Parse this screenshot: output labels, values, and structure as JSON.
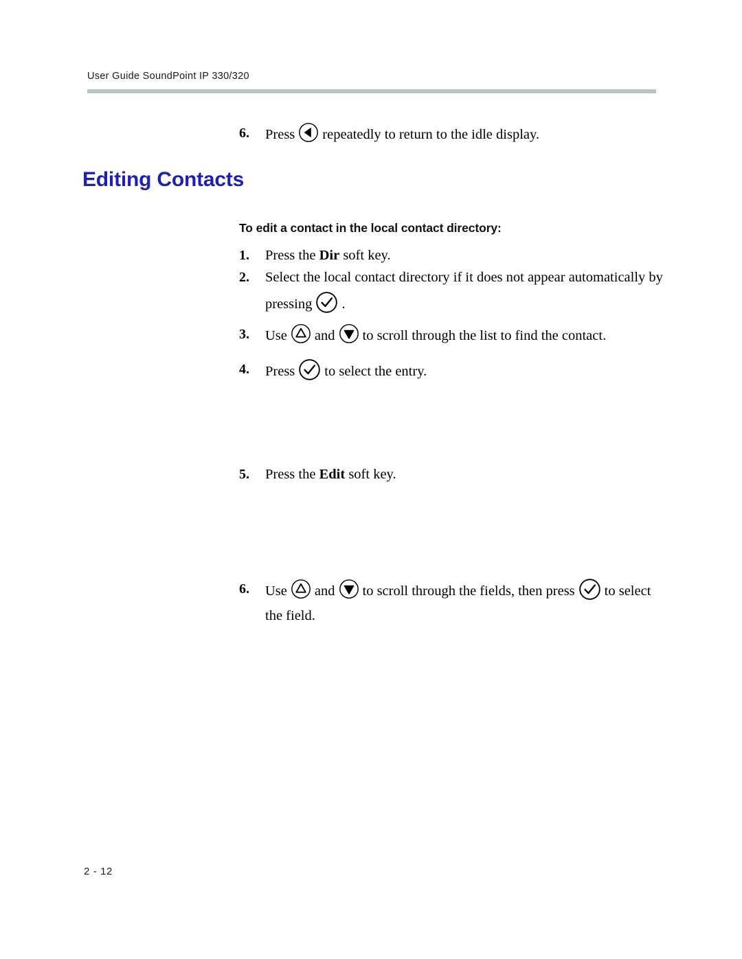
{
  "header": {
    "running_title": "User Guide SoundPoint IP 330/320",
    "rule_color": "#b9c4c6"
  },
  "footer": {
    "page_number": "2 - 12"
  },
  "top_step": {
    "number": "6.",
    "text_before": "Press",
    "icon": "left-arrow-key-icon",
    "text_after": "repeatedly to return to the idle display."
  },
  "section": {
    "title": "Editing Contacts",
    "title_color": "#1f1fb4"
  },
  "procedure": {
    "heading": "To edit a contact in the local contact directory:",
    "steps": [
      {
        "number": "1.",
        "parts": [
          {
            "type": "text",
            "value": "Press the "
          },
          {
            "type": "bold",
            "value": "Dir"
          },
          {
            "type": "text",
            "value": " soft key."
          }
        ],
        "plain": "Press the Dir soft key."
      },
      {
        "number": "2.",
        "line1": "Select the local contact directory if it does not appear automatically by",
        "line2_before": "pressing",
        "line2_icon": "checkmark-key-icon",
        "line2_after": ".",
        "plain": "Select the local contact directory if it does not appear automatically by pressing ."
      },
      {
        "number": "3.",
        "text_before": "Use",
        "icon_1": "up-arrow-key-icon",
        "text_middle": "and",
        "icon_2": "down-arrow-key-icon",
        "text_after": "to scroll through the list to find the contact.",
        "plain": "Use and to scroll through the list to find the contact."
      },
      {
        "number": "4.",
        "text_before": "Press",
        "icon": "checkmark-key-icon",
        "text_after": "to select the entry.",
        "plain": "Press to select the entry."
      },
      {
        "number": "5.",
        "parts": [
          {
            "type": "text",
            "value": "Press the "
          },
          {
            "type": "bold",
            "value": "Edit"
          },
          {
            "type": "text",
            "value": " soft key."
          }
        ],
        "plain": "Press the Edit soft key."
      },
      {
        "number": "6.",
        "text_before": "Use",
        "icon_1": "up-arrow-key-icon",
        "text_middle": "and",
        "icon_2": "down-arrow-key-icon",
        "text_middle_2": "to scroll through the fields, then press",
        "icon_3": "checkmark-key-icon",
        "text_after": "to select",
        "line2": "the field.",
        "plain": "Use and to scroll through the fields, then press to select the field."
      }
    ]
  }
}
